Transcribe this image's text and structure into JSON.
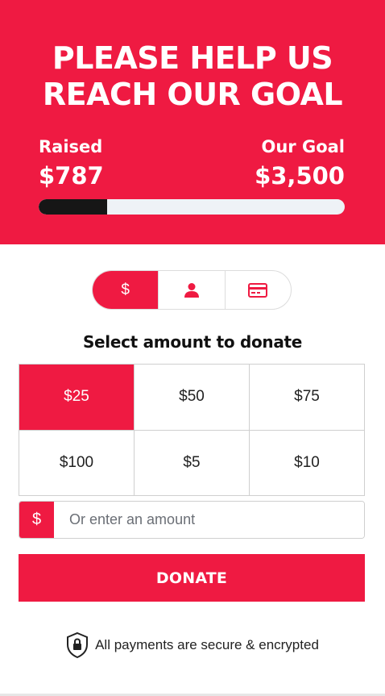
{
  "hero": {
    "title_line1": "PLEASE HELP US",
    "title_line2": "REACH OUR GOAL",
    "raised_label": "Raised",
    "raised_value": "$787",
    "goal_label": "Our Goal",
    "goal_value": "$3,500",
    "progress_fraction": 0.2249
  },
  "payment_tabs": [
    {
      "icon": "dollar-icon",
      "glyph": "$",
      "active": true
    },
    {
      "icon": "user-icon",
      "active": false
    },
    {
      "icon": "credit-card-icon",
      "active": false
    }
  ],
  "section_title": "Select amount to donate",
  "amounts": [
    {
      "label": "$25",
      "selected": true
    },
    {
      "label": "$50",
      "selected": false
    },
    {
      "label": "$75",
      "selected": false
    },
    {
      "label": "$100",
      "selected": false
    },
    {
      "label": "$5",
      "selected": false
    },
    {
      "label": "$10",
      "selected": false
    }
  ],
  "custom_amount": {
    "prefix": "$",
    "placeholder": "Or enter an amount",
    "value": ""
  },
  "donate_label": "DONATE",
  "secure_text": "All payments are secure & encrypted",
  "colors": {
    "accent": "#ef1a42",
    "progress_fill": "#161616",
    "progress_track": "#eef2f6"
  }
}
